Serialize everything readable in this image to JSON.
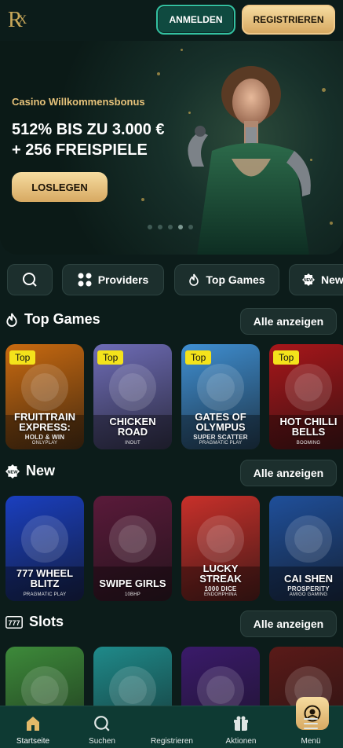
{
  "header": {
    "logo_text": "R",
    "logo_sub": "X",
    "login_label": "ANMELDEN",
    "register_label": "REGISTRIEREN"
  },
  "hero": {
    "kicker": "Casino Willkommensbonus",
    "title": "512% BIS ZU 3.000 € + 256 FREISPIELE",
    "cta_label": "LOSLEGEN",
    "slide_count": 5,
    "active_slide": 3
  },
  "chips": [
    {
      "label": "",
      "icon": "search-icon"
    },
    {
      "label": "Providers",
      "icon": "grid-icon"
    },
    {
      "label": "Top Games",
      "icon": "flame-icon"
    },
    {
      "label": "New",
      "icon": "new-badge-icon"
    }
  ],
  "sections": [
    {
      "title": "Top Games",
      "icon": "flame-icon",
      "all_label": "Alle anzeigen",
      "tiles": [
        {
          "badge": "Top",
          "name": "FRUITTRAIN EXPRESS:",
          "sub_title": "HOLD & WIN",
          "provider": "ONLYPLAY",
          "bg": "#c96a10"
        },
        {
          "badge": "Top",
          "name": "CHICKEN ROAD",
          "sub_title": "",
          "provider": "INOUT",
          "bg": "#6e6cb6"
        },
        {
          "badge": "Top",
          "name": "GATES OF OLYMPUS",
          "sub_title": "SUPER SCATTER",
          "provider": "PRAGMATIC PLAY",
          "bg": "#3f8fd2"
        },
        {
          "badge": "Top",
          "name": "HOT CHILLI BELLS",
          "sub_title": "",
          "provider": "BOOMING",
          "bg": "#a8161a"
        }
      ]
    },
    {
      "title": "New",
      "icon": "new-badge-icon",
      "all_label": "Alle anzeigen",
      "tiles": [
        {
          "badge": "",
          "name": "777 WHEEL BLITZ",
          "sub_title": "",
          "provider": "PRAGMATIC PLAY",
          "bg": "#1a3fbf"
        },
        {
          "badge": "",
          "name": "SWIPE GIRLS",
          "sub_title": "",
          "provider": "10BHP",
          "bg": "#5a1a3a"
        },
        {
          "badge": "",
          "name": "LUCKY STREAK",
          "sub_title": "1000 DICE",
          "provider": "ENDORPHINA",
          "bg": "#c8302a"
        },
        {
          "badge": "",
          "name": "CAI SHEN",
          "sub_title": "PROSPERITY",
          "provider": "AMIGO GAMING",
          "bg": "#1f4f9a"
        }
      ]
    },
    {
      "title": "Slots",
      "icon": "slot-777-icon",
      "all_label": "Alle anzeigen",
      "tiles": [
        {
          "badge": "",
          "name": "",
          "sub_title": "",
          "provider": "",
          "bg": "#3d8a3a"
        },
        {
          "badge": "",
          "name": "",
          "sub_title": "",
          "provider": "",
          "bg": "#1f8a8a"
        },
        {
          "badge": "",
          "name": "",
          "sub_title": "",
          "provider": "",
          "bg": "#3a1a6a"
        },
        {
          "badge": "",
          "name": "",
          "sub_title": "",
          "provider": "",
          "bg": "#5a1a18"
        }
      ]
    }
  ],
  "nav": [
    {
      "label": "Startseite",
      "icon": "home-icon",
      "active": true
    },
    {
      "label": "Suchen",
      "icon": "search-icon",
      "active": false
    },
    {
      "label": "Registrieren",
      "icon": "user-circle-icon",
      "active": false
    },
    {
      "label": "Aktionen",
      "icon": "gift-icon",
      "active": false
    },
    {
      "label": "Menü",
      "icon": "menu-icon",
      "active": false
    }
  ],
  "colors": {
    "background": "#0c1c1a",
    "accent_gold": "#d7a962",
    "accent_teal": "#33c0a0",
    "badge_yellow": "#f4e31b"
  }
}
